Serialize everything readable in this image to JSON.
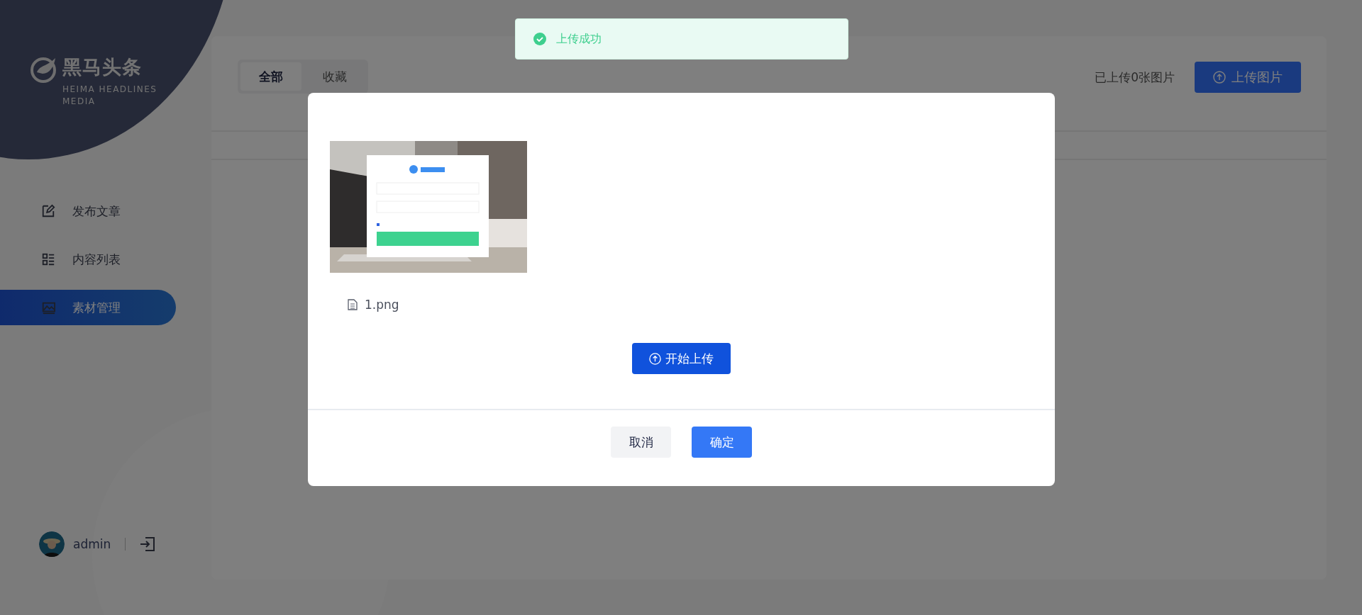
{
  "sidebar": {
    "logo_title": "黑马头条",
    "logo_subtitle": "HEIMA HEADLINES MEDIA",
    "nav": [
      {
        "label": "发布文章",
        "selected": false
      },
      {
        "label": "内容列表",
        "selected": false
      },
      {
        "label": "素材管理",
        "selected": true
      }
    ],
    "user": {
      "name": "admin"
    }
  },
  "content": {
    "tabs": [
      {
        "label": "全部",
        "selected": true
      },
      {
        "label": "收藏",
        "selected": false
      }
    ],
    "upload_count": "已上传0张图片",
    "upload_button": "上传图片"
  },
  "dialog": {
    "file_name": "1.png",
    "start_button": "开始上传",
    "cancel_button": "取消",
    "confirm_button": "确定"
  },
  "toast": {
    "message": "上传成功"
  }
}
